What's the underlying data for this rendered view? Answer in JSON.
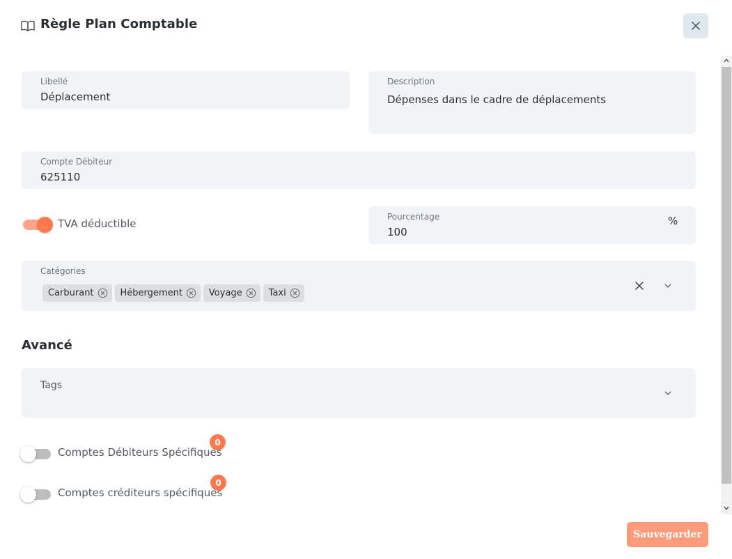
{
  "dialog": {
    "title": "Règle Plan Comptable",
    "title_icon": "book-open-icon",
    "close_icon": "close-icon"
  },
  "form": {
    "libelle": {
      "label": "Libellé",
      "value": "Déplacement"
    },
    "description": {
      "label": "Description",
      "value": "Dépenses dans le cadre de déplacements"
    },
    "compte_debiteur": {
      "label": "Compte Débiteur",
      "value": "625110"
    },
    "tva": {
      "label": "TVA déductible",
      "checked": true
    },
    "pourcentage": {
      "label": "Pourcentage",
      "value": "100",
      "suffix": "%"
    },
    "categories": {
      "label": "Catégories",
      "chips": [
        "Carburant",
        "Hébergement",
        "Voyage",
        "Taxi"
      ],
      "clear_icon": "clear-x-icon",
      "dropdown_icon": "chevron-down-icon"
    }
  },
  "advanced": {
    "title": "Avancé",
    "tags": {
      "label": "Tags",
      "dropdown_icon": "chevron-down-icon"
    },
    "comptes_debiteurs": {
      "label": "Comptes Débiteurs Spécifiques",
      "count": "0",
      "checked": false
    },
    "comptes_crediteurs": {
      "label": "Comptes créditeurs spécifiques",
      "count": "0",
      "checked": false
    }
  },
  "actions": {
    "save_label": "Sauvegarder"
  },
  "colors": {
    "accent": "#ff7950",
    "field_bg": "#f1f4f7",
    "save_button": "#ff9a7a",
    "close_button_bg": "#dfe8ec"
  }
}
